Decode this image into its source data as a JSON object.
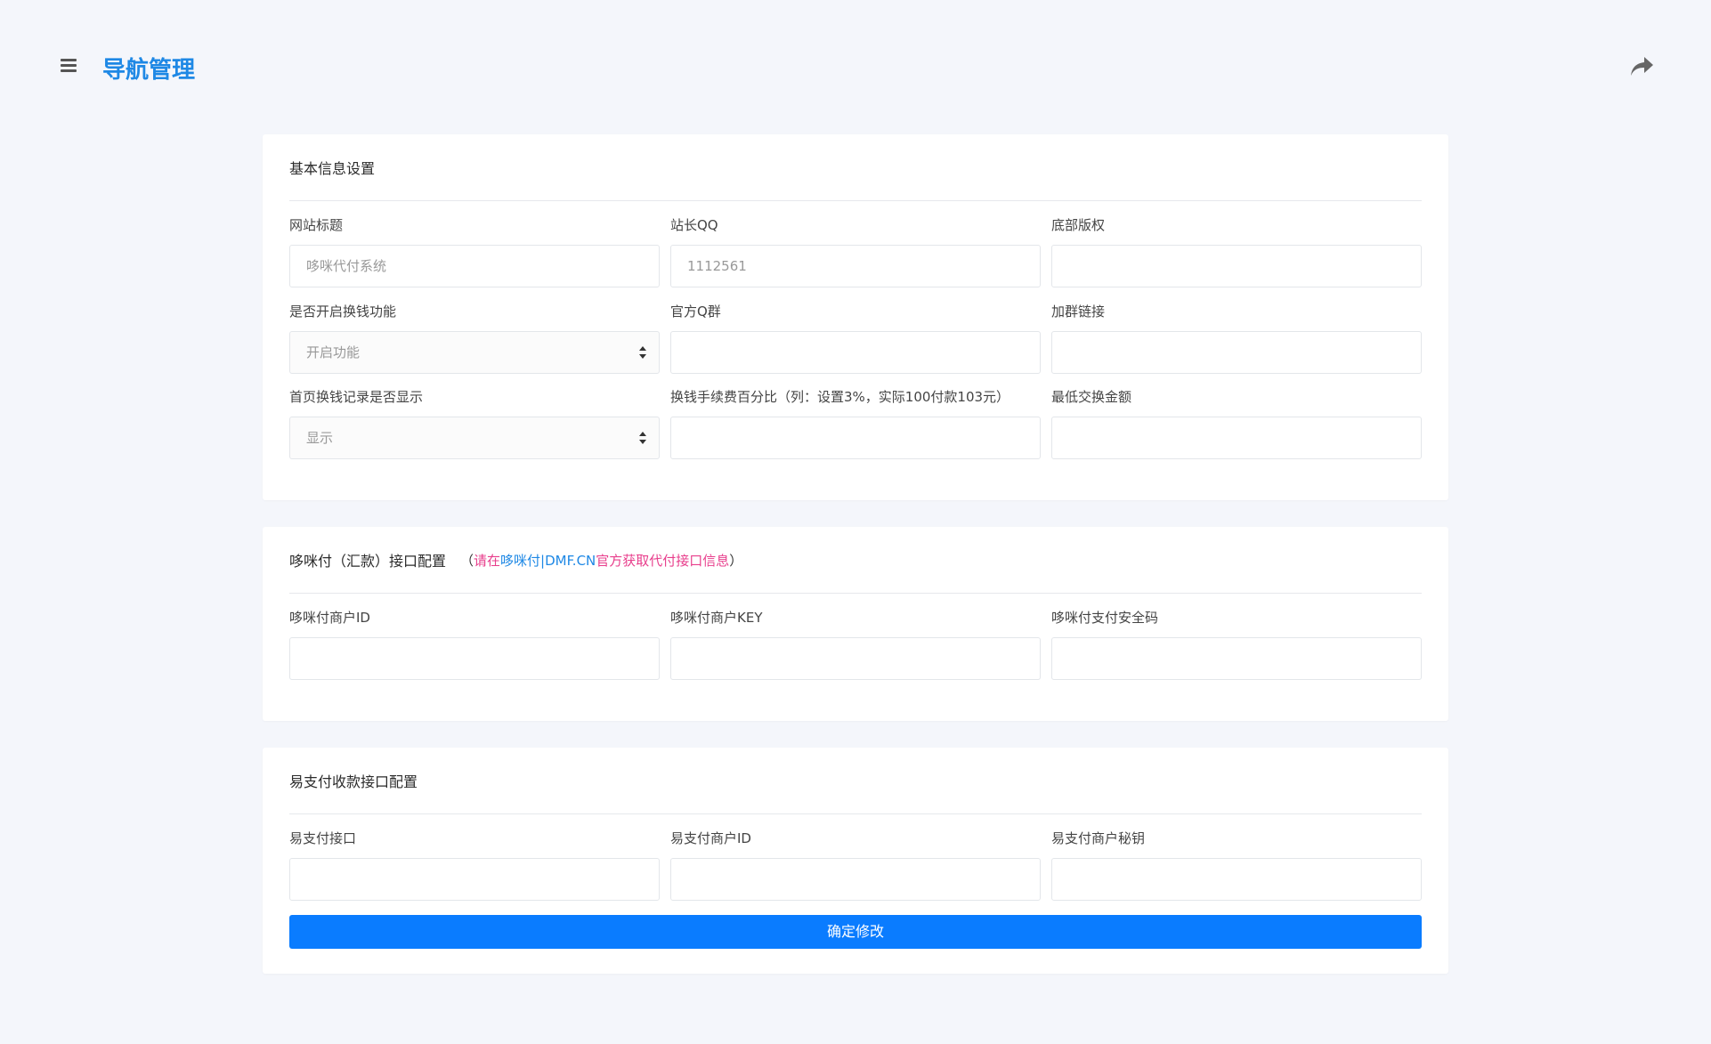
{
  "header": {
    "title": "导航管理",
    "menu_icon": "hamburger-icon",
    "share_icon": "share-arrow-icon"
  },
  "basic": {
    "title": "基本信息设置",
    "site_title": {
      "label": "网站标题",
      "placeholder": "哆咪代付系统"
    },
    "webmaster_qq": {
      "label": "站长QQ",
      "placeholder": "1112561"
    },
    "footer_copyright": {
      "label": "底部版权",
      "placeholder": ""
    },
    "exchange_enable": {
      "label": "是否开启换钱功能",
      "value": "开启功能"
    },
    "official_group": {
      "label": "官方Q群",
      "placeholder": ""
    },
    "group_link": {
      "label": "加群链接",
      "placeholder": ""
    },
    "home_record": {
      "label": "首页换钱记录是否显示",
      "value": "显示"
    },
    "fee_percent": {
      "label": "换钱手续费百分比（列：设置3%，实际100付款103元）",
      "placeholder": ""
    },
    "min_amount": {
      "label": "最低交换金额",
      "placeholder": ""
    }
  },
  "dmf": {
    "title": "哆咪付（汇款）接口配置",
    "hint_open": "（",
    "hint_pre": "请在",
    "hint_link": "哆咪付|DMF.CN",
    "hint_post": "官方获取代付接口信息",
    "hint_close": "）",
    "merchant_id": {
      "label": "哆咪付商户ID",
      "placeholder": ""
    },
    "merchant_key": {
      "label": "哆咪付商户KEY",
      "placeholder": ""
    },
    "security_code": {
      "label": "哆咪付支付安全码",
      "placeholder": ""
    }
  },
  "epay": {
    "title": "易支付收款接口配置",
    "api": {
      "label": "易支付接口",
      "placeholder": ""
    },
    "merchant_id": {
      "label": "易支付商户ID",
      "placeholder": ""
    },
    "merchant_secret": {
      "label": "易支付商户秘钥",
      "placeholder": ""
    },
    "submit_label": "确定修改"
  },
  "colors": {
    "accent": "#1e88e5",
    "button": "#0a7cff",
    "background": "#f4f6fb",
    "hint_red": "#e83e8c"
  }
}
